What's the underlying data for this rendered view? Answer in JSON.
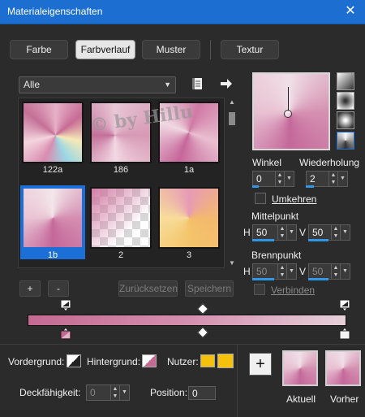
{
  "window": {
    "title": "Materialeigenschaften",
    "close_glyph": "✕"
  },
  "tabs": [
    {
      "label": "Farbe"
    },
    {
      "label": "Farbverlauf"
    },
    {
      "label": "Muster"
    },
    {
      "label": "Textur"
    }
  ],
  "gallery": {
    "category": "Alle",
    "items": [
      {
        "label": "122a"
      },
      {
        "label": "186"
      },
      {
        "label": "1a"
      },
      {
        "label": "1b"
      },
      {
        "label": "2"
      },
      {
        "label": "3"
      }
    ],
    "watermark": "© by Hillu",
    "selected": "1b"
  },
  "buttons": {
    "add": "+",
    "remove": "-",
    "reset": "Zurücksetzen",
    "save": "Speichern",
    "new": "+"
  },
  "settings": {
    "angle_label": "Winkel",
    "angle_value": "0",
    "repeat_label": "Wiederholung",
    "repeat_value": "2",
    "invert_label": "Umkehren",
    "center_label": "Mittelpunkt",
    "center_h": "50",
    "center_v": "50",
    "focus_label": "Brennpunkt",
    "focus_h": "50",
    "focus_v": "50",
    "h_label": "H",
    "v_label": "V",
    "link_label": "Verbinden"
  },
  "gradient_editor": {
    "colors": {
      "start": "#c46a92",
      "middle": "#d48fae",
      "end": "#e6d0d8"
    }
  },
  "bottom": {
    "foreground_label": "Vordergrund:",
    "background_label": "Hintergrund:",
    "user_label": "Nutzer:",
    "opacity_label": "Deckfähigkeit:",
    "opacity_value": "0",
    "position_label": "Position:",
    "position_value": "0",
    "current_label": "Aktuell",
    "previous_label": "Vorher",
    "user_color": "#f4c20d"
  },
  "icons": [
    "list-icon",
    "arrow-right-icon",
    "close-icon",
    "chevron-down-icon"
  ]
}
